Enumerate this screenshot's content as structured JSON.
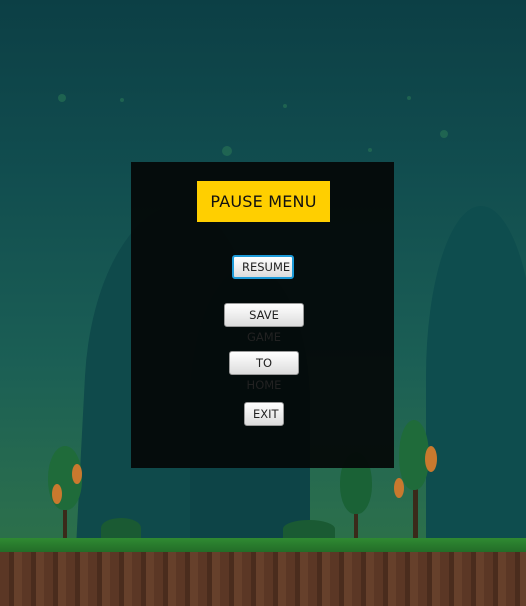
{
  "pause_menu": {
    "title": "PAUSE MENU",
    "buttons": {
      "resume": "RESUME",
      "save_game": "SAVE GAME",
      "to_home": "TO HOME",
      "exit": "EXIT"
    },
    "focused_button": "resume"
  },
  "colors": {
    "title_background": "#ffcf00",
    "panel_background": "#040808",
    "focus_ring": "#1c9ad8",
    "sky_top": "#0c3f45",
    "grass": "#2f8a32",
    "dirt": "#5b3725"
  }
}
